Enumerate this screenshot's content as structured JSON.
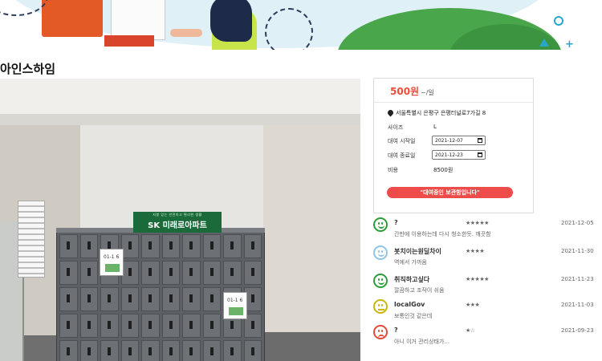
{
  "page": {
    "title": "아인스하임"
  },
  "listing": {
    "price": "500원",
    "price_unit": "~/일",
    "address": "서울특별시 은평구 은평터널로7가길 8",
    "size_label": "사이즈",
    "size_value": "L",
    "start_label": "대여 시작일",
    "start_date": "2021-12-07",
    "end_label": "대여 종료일",
    "end_date": "2021-12-23",
    "cost_label": "비용",
    "cost_value": "8500원",
    "status_button": "\"대여중인 보관함입니다\""
  },
  "photo": {
    "sign_text": "SK 미래로아파트",
    "sign_small": "지붕 있는 안전하고 편리한 생활",
    "poster_text": "01-1 6"
  },
  "reviews": [
    {
      "name": "?",
      "stars": "★★★★★",
      "date": "2021-12-05",
      "text": "간만에 이용하는데 다시 청소한듯. 깨끗함",
      "mood": "happy",
      "color": "#2e9e3c"
    },
    {
      "name": "봇치이는원딜차이",
      "stars": "★★★★",
      "date": "2021-11-30",
      "text": "역에서 가까움",
      "mood": "happy",
      "color": "#8fc6e6"
    },
    {
      "name": "취직하고싶다",
      "stars": "★★★★★",
      "date": "2021-11-23",
      "text": "깔끔하고 조작이 쉬움",
      "mood": "happy",
      "color": "#2e9e3c"
    },
    {
      "name": "localGov",
      "stars": "★★★",
      "date": "2021-11-03",
      "text": "보통인것 같은데",
      "mood": "neutral",
      "color": "#c9b70e"
    },
    {
      "name": "?",
      "stars": "★☆",
      "date": "2021-09-23",
      "text": "아니 이거 관리상태가...",
      "mood": "sad",
      "color": "#e14b3a"
    }
  ]
}
